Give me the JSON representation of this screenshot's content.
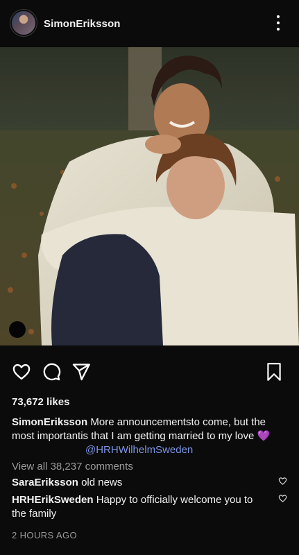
{
  "post": {
    "username": "SimonEriksson",
    "likes": "73,672 likes",
    "caption_user": "SimonEriksson",
    "caption_text": "More announcementsto come, but the most importantis that I am getting married to my love",
    "caption_emoji": "💜",
    "caption_mention": "@HRHWilhelmSweden",
    "view_all": "View all 38,237 comments",
    "comments": [
      {
        "user": "SaraEriksson",
        "text": "old news"
      },
      {
        "user": "HRHErikSweden",
        "text": "Happy to officially welcome you to the family"
      }
    ],
    "timestamp": "2 HOURS AGO"
  },
  "icons": {
    "more": "more-vertical-icon",
    "like": "heart-icon",
    "comment": "comment-icon",
    "share": "send-icon",
    "save": "bookmark-icon"
  },
  "colors": {
    "background": "#0b0b0b",
    "text": "#f2f2f2",
    "secondary_text": "#9a9a9a",
    "mention": "#7c95e8"
  }
}
